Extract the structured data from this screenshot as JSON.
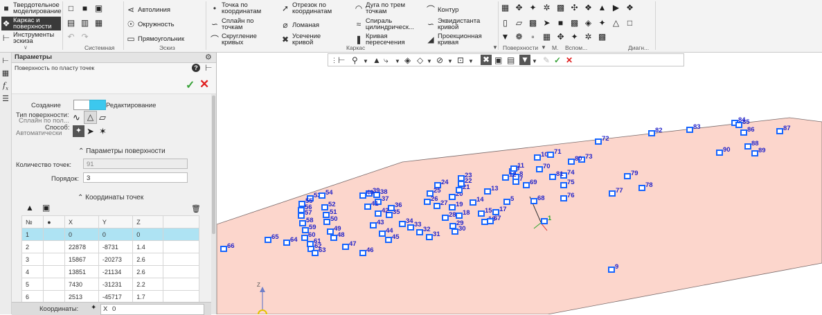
{
  "ribbon": {
    "col1": [
      "Твердотельное моделирование",
      "Каркас и поверхности",
      "Инструменты эскиза"
    ],
    "sistemnaya": "Системная",
    "eskiz": {
      "label": "Эскиз",
      "items": [
        "Автолиния",
        "Окружность",
        "Прямоугольник"
      ]
    },
    "karkas": {
      "label": "Каркас",
      "items": [
        "Точка по координатам",
        "Сплайн по точкам",
        "Скругление кривых",
        "Отрезок по координатам",
        "Ломаная",
        "Усечение кривой",
        "Дуга по трем точкам",
        "Спираль цилиндрическ...",
        "Кривая пересечения",
        "Контур",
        "Эквидистанта кривой",
        "Проекционная кривая"
      ]
    },
    "groups": [
      "Поверхности",
      "М.",
      "Вспом...",
      "Диагн..."
    ]
  },
  "panel": {
    "title": "Параметры",
    "subtitle": "Поверхность по пласту точек",
    "mode_create": "Создание",
    "mode_edit": "Редактирование",
    "surface_type_label": "Тип поверхности:",
    "surface_type_value": "Сплайн по пол...",
    "method_label": "Способ:",
    "method_value": "Автоматически",
    "section_surface": "Параметры поверхности",
    "point_count_label": "Количество точек:",
    "point_count_value": "91",
    "order_label": "Порядок:",
    "order_value": "3",
    "section_coords": "Координаты точек",
    "table": {
      "headers": [
        "№",
        "●",
        "X",
        "Y",
        "Z"
      ],
      "rows": [
        [
          "1",
          "",
          "0",
          "0",
          "0"
        ],
        [
          "2",
          "",
          "22878",
          "-8731",
          "1.4"
        ],
        [
          "3",
          "",
          "15867",
          "-20273",
          "2.6"
        ],
        [
          "4",
          "",
          "13851",
          "-21134",
          "2.6"
        ],
        [
          "5",
          "",
          "7430",
          "-31231",
          "2.2"
        ],
        [
          "6",
          "",
          "2513",
          "-45717",
          "1.7"
        ]
      ]
    },
    "coords_label": "Координаты:",
    "coords_axis": "X",
    "coords_value": "0"
  },
  "viewport": {
    "axis_label": "Z",
    "points": [
      "1",
      "5",
      "6",
      "7",
      "8",
      "9",
      "10",
      "11",
      "12",
      "13",
      "14",
      "15",
      "16",
      "17",
      "18",
      "19",
      "20",
      "21",
      "22",
      "23",
      "24",
      "25",
      "26",
      "27",
      "28",
      "29",
      "30",
      "31",
      "32",
      "33",
      "34",
      "35",
      "36",
      "37",
      "38",
      "39",
      "40",
      "41",
      "42",
      "43",
      "44",
      "45",
      "46",
      "47",
      "48",
      "49",
      "50",
      "51",
      "52",
      "53",
      "54",
      "55",
      "56",
      "57",
      "58",
      "59",
      "60",
      "61",
      "62",
      "63",
      "64",
      "65",
      "66",
      "67",
      "68",
      "69",
      "70",
      "71",
      "72",
      "73",
      "74",
      "75",
      "76",
      "77",
      "78",
      "79",
      "80",
      "81",
      "82",
      "83",
      "84",
      "85",
      "86",
      "87",
      "88",
      "89",
      "90"
    ]
  },
  "colors": {
    "point_marker": "#1565ff",
    "point_label": "#2424c8",
    "surface": "#fcd6cc",
    "selection": "#aee3f3",
    "accept": "#3aa33a",
    "cancel": "#e02020"
  }
}
